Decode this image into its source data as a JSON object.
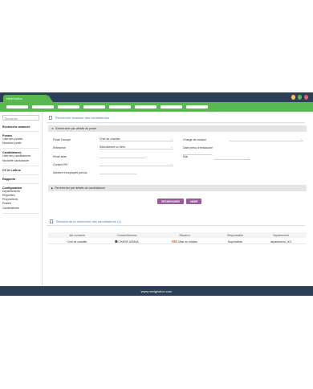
{
  "browser": {
    "tab_label": "NextGestion",
    "dot_colors": [
      "#f5c542",
      "#59b84f",
      "#e35d6a"
    ]
  },
  "navbar": {
    "pill_count": 8
  },
  "sidebar": {
    "search_value": "Recherche",
    "search_heading": "Recherche avancée",
    "sections": [
      {
        "heading": "Postes",
        "items": [
          "Liste des postes",
          "Nouveau poste"
        ]
      },
      {
        "heading": "Candidatures",
        "items": [
          "Liste des candidatures",
          "Nouvelle candidature"
        ]
      },
      {
        "heading": "CV et Lettres",
        "items": []
      },
      {
        "heading": "Rapports",
        "items": []
      },
      {
        "heading": "Configuration",
        "items": [
          "Departements",
          "Etiquettes",
          "Propositions",
          "Postes",
          "Candidatures"
        ]
      }
    ]
  },
  "main": {
    "title": "Recherche avancée des candidatures",
    "panel_poste": {
      "header": "Rechercher par détails du poste",
      "fields": {
        "poste_label": "Poste Occupé",
        "poste_value": "Chef de chantier",
        "entreprise_label": "Entreprise",
        "entreprise_value": "Sélectionner un tiers",
        "email_label": "Email alias",
        "contact_label": "Contact RH",
        "nb_employes_label": "Nombre d'employés prévus",
        "charge_label": "Chargé de mission",
        "date_label": "Date prévu d'embauche",
        "etat_label": "Etat"
      }
    },
    "panel_cand": {
      "header": "Rechercher par détails de candidatures"
    },
    "buttons": {
      "search": "RECHERCHER",
      "reset": "VIDER"
    },
    "results": {
      "title": "Résultat de la recherche des candidatures",
      "count": "(1)",
      "columns": [
        "Job concerné",
        "Contact/Adresse",
        "Situation",
        "Responsable",
        "Departement"
      ],
      "rows": [
        [
          "Chef de chantier",
          "CHARIF ASMAA",
          "Mise en relation",
          "Superadmin",
          "departement_001"
        ]
      ]
    }
  },
  "footer": {
    "text": "www.nextgestion.com"
  }
}
